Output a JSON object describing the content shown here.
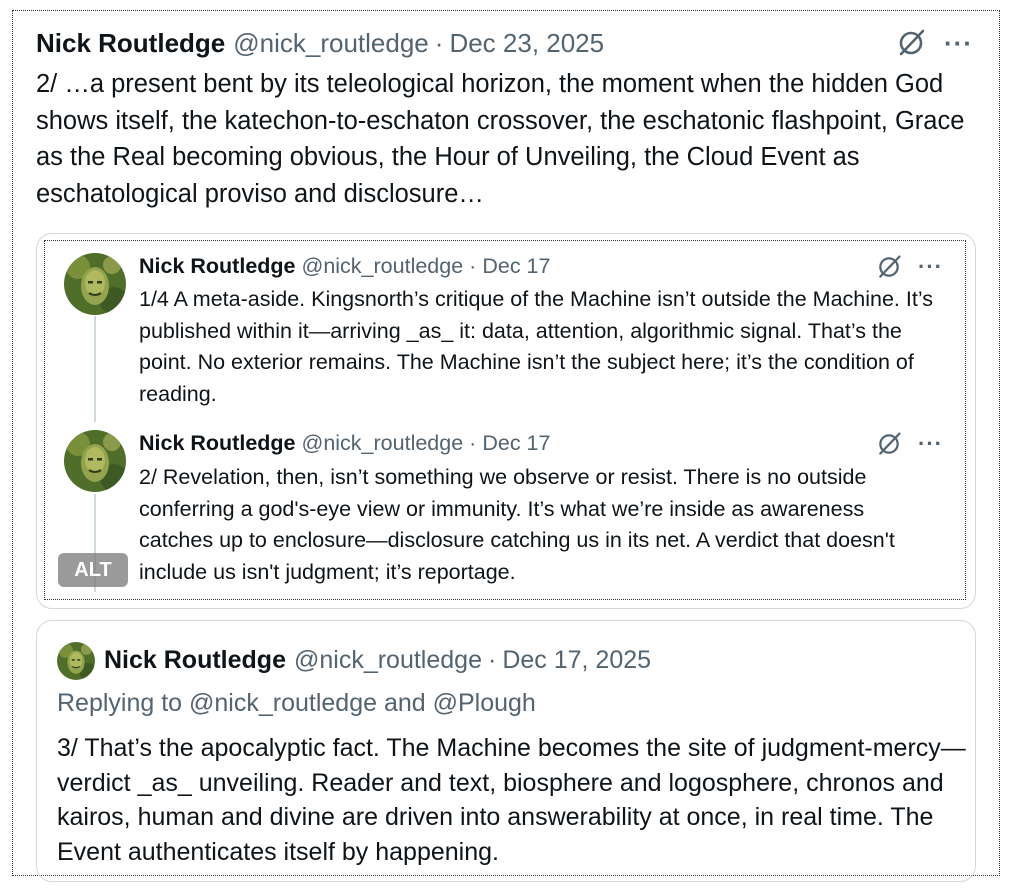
{
  "main_tweet": {
    "author_name": "Nick Routledge",
    "handle": "@nick_routledge",
    "separator": "·",
    "date": "Dec 23, 2025",
    "more_label": "···",
    "text": "2/ …a present bent by its teleological horizon, the moment when the hidden God shows itself, the katechon-to-eschaton crossover, the eschatonic flashpoint, Grace as the Real becoming obvious, the Hour of Unveiling, the Cloud Event as eschatological proviso and disclosure…"
  },
  "quoted_image": {
    "alt_badge": "ALT",
    "posts": [
      {
        "author_name": "Nick Routledge",
        "handle": "@nick_routledge",
        "separator": "·",
        "date": "Dec 17",
        "more_label": "···",
        "text": "1/4 A meta-aside. Kingsnorth’s critique of the Machine isn’t outside the Machine. It’s published within it—arriving _as_ it: data, attention, algorithmic signal. That’s the point. No exterior remains. The Machine isn’t the subject here; it’s the condition of reading."
      },
      {
        "author_name": "Nick Routledge",
        "handle": "@nick_routledge",
        "separator": "·",
        "date": "Dec 17",
        "more_label": "···",
        "text": "2/ Revelation, then, isn’t something we observe or resist. There is no outside conferring a god's-eye view or immunity. It’s what we’re inside as awareness catches up to enclosure—disclosure catching us in its net. A verdict that doesn't include us isn't judgment; it’s reportage."
      }
    ]
  },
  "reply_card": {
    "author_name": "Nick Routledge",
    "handle": "@nick_routledge",
    "separator": "·",
    "date": "Dec 17, 2025",
    "replying_to": "Replying to @nick_routledge and @Plough",
    "text": "3/ That’s the apocalyptic fact. The Machine becomes the site of judgment-mercy—verdict _as_ unveiling. Reader and text, biosphere and logosphere, chronos and kairos, human and divine are driven into answerability at once, in real time. The Event authenticates itself by happening."
  },
  "colors": {
    "text": "#0f1419",
    "secondary": "#536471",
    "border": "#cfd9de"
  }
}
